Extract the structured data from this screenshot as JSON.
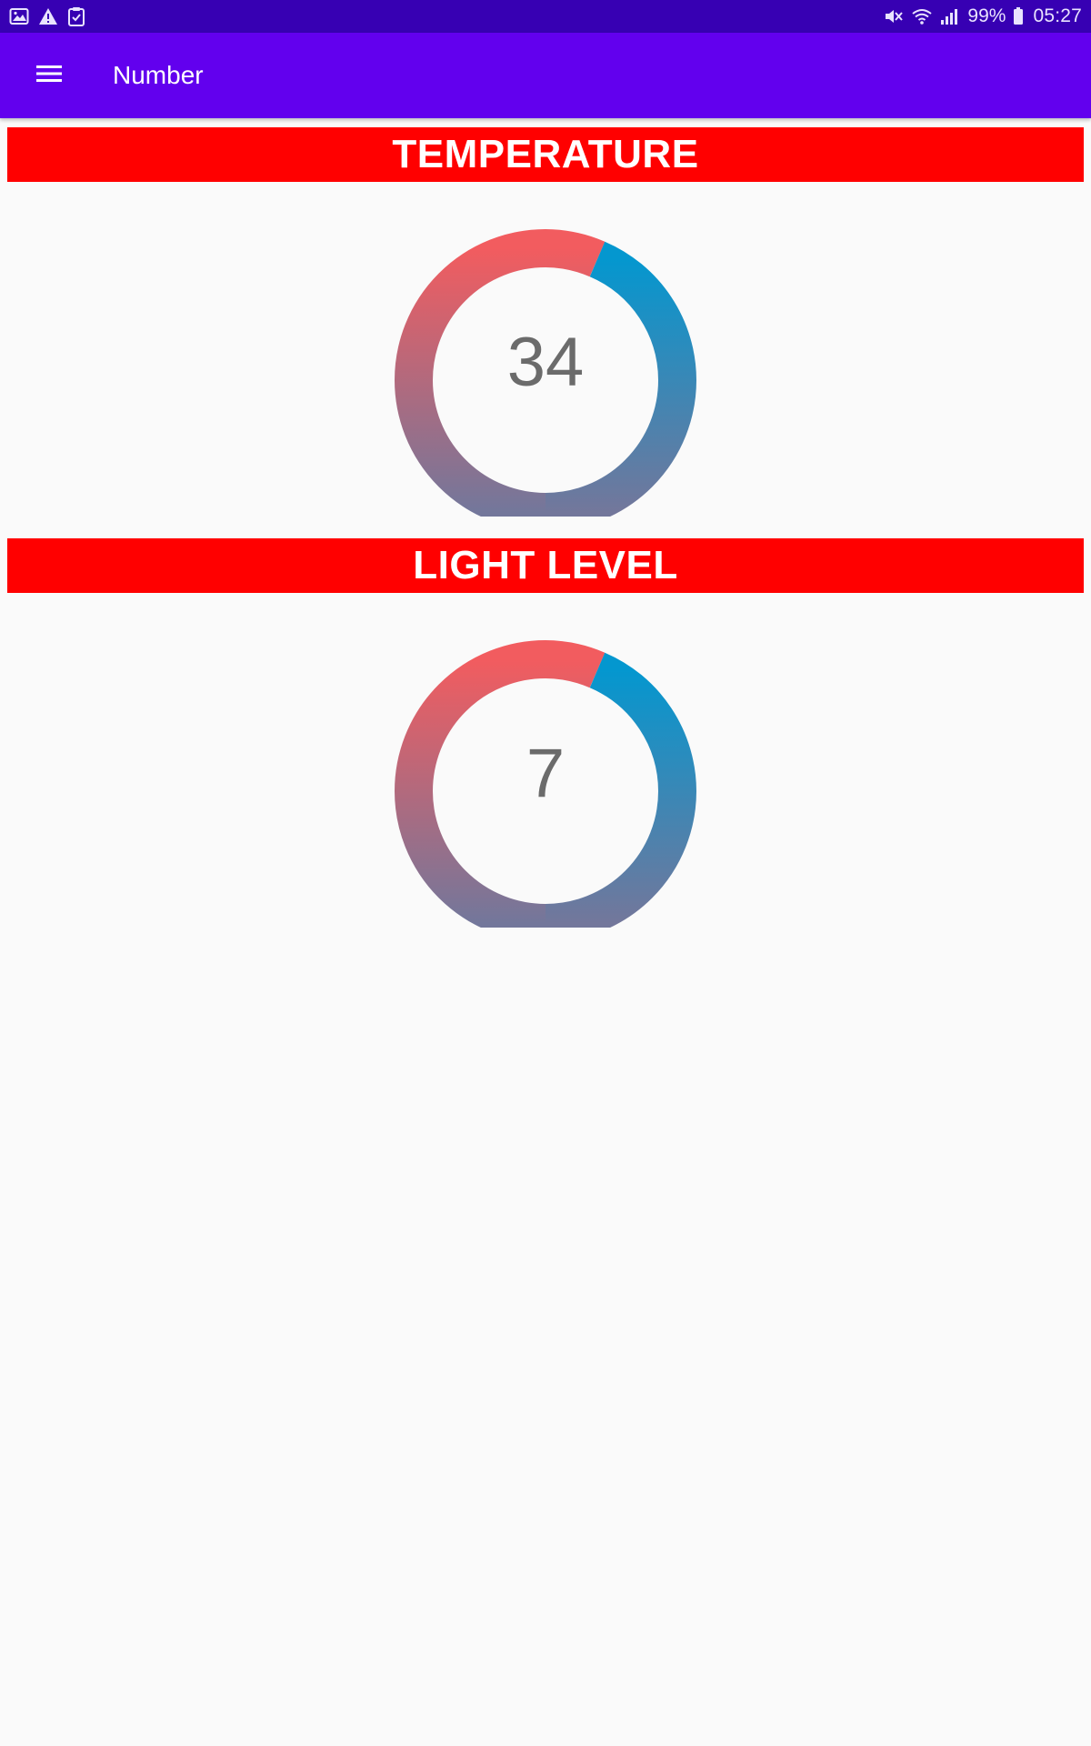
{
  "status_bar": {
    "battery": "99%",
    "time": "05:27",
    "left_icons": [
      "image-icon",
      "warning-icon",
      "clipboard-check-icon"
    ],
    "right_icons": [
      "mute-icon",
      "wifi-icon",
      "signal-icon",
      "battery-icon"
    ]
  },
  "app_bar": {
    "title": "Number",
    "menu_icon": "hamburger-menu-icon",
    "color": "#6200ee"
  },
  "sections": [
    {
      "title": "TEMPERATURE",
      "value": "34"
    },
    {
      "title": "LIGHT LEVEL",
      "value": "7"
    }
  ],
  "colors": {
    "header_bg": "#ff0000",
    "ring_red": "#f25c5f",
    "ring_blue": "#0497cf",
    "ring_bottom": "#73779b"
  }
}
